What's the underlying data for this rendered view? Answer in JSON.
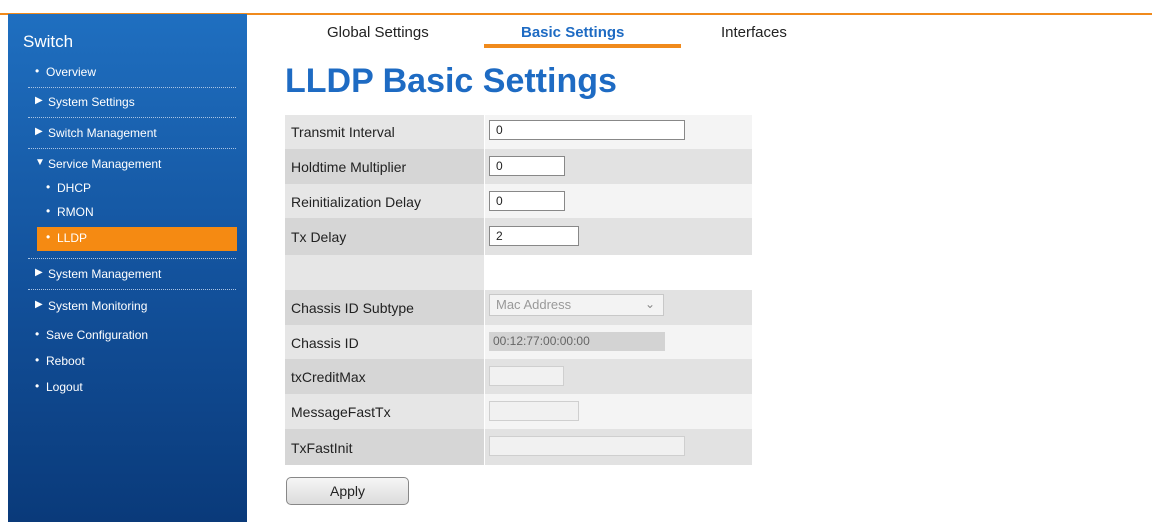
{
  "sidebar": {
    "title": "Switch",
    "items": [
      {
        "label": "Overview",
        "bullet": "•"
      },
      {
        "label": "System Settings",
        "bullet": "▶"
      },
      {
        "label": "Switch Management",
        "bullet": "▶"
      },
      {
        "label": "Service Management",
        "bullet": "▼"
      },
      {
        "label": "DHCP",
        "bullet": "•"
      },
      {
        "label": "RMON",
        "bullet": "•"
      },
      {
        "label": "LLDP",
        "bullet": "•"
      },
      {
        "label": "System Management",
        "bullet": "▶"
      },
      {
        "label": "System Monitoring",
        "bullet": "▶"
      },
      {
        "label": "Save Configuration",
        "bullet": "•"
      },
      {
        "label": "Reboot",
        "bullet": "•"
      },
      {
        "label": "Logout",
        "bullet": "•"
      }
    ]
  },
  "tabs": [
    {
      "label": "Global Settings"
    },
    {
      "label": "Basic Settings"
    },
    {
      "label": "Interfaces"
    }
  ],
  "page": {
    "title": "LLDP Basic Settings"
  },
  "form": {
    "rows": [
      {
        "label": "Transmit Interval",
        "value": "0"
      },
      {
        "label": "Holdtime Multiplier",
        "value": "0"
      },
      {
        "label": "Reinitialization Delay",
        "value": "0"
      },
      {
        "label": "Tx Delay",
        "value": "2"
      },
      {
        "label": "",
        "value": ""
      },
      {
        "label": "Chassis ID Subtype",
        "value": "Mac Address"
      },
      {
        "label": "Chassis ID",
        "value": "00:12:77:00:00:00"
      },
      {
        "label": "txCreditMax",
        "value": ""
      },
      {
        "label": "MessageFastTx",
        "value": ""
      },
      {
        "label": "TxFastInit",
        "value": ""
      }
    ],
    "apply_label": "Apply"
  },
  "colors": {
    "accent": "#f08a1c",
    "brand_blue": "#1e6bc3",
    "sidebar_blue": "#1a5fae"
  },
  "icons": {
    "dropdown": "chevron-down-icon",
    "bullet": "bullet-icon",
    "expand": "triangle-right-icon",
    "collapse": "triangle-down-icon"
  }
}
